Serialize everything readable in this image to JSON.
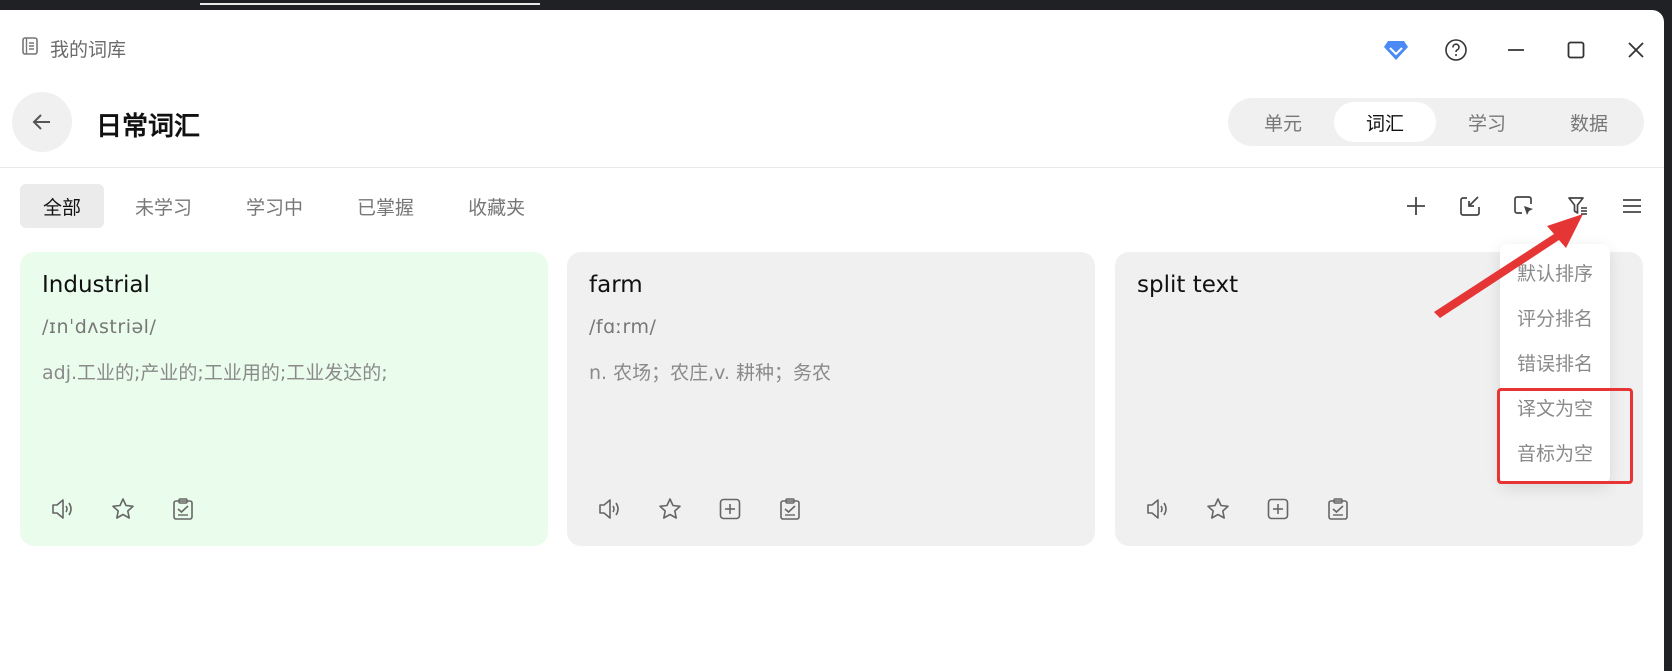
{
  "window": {
    "title": "我的词库"
  },
  "header": {
    "title": "日常词汇",
    "segments": [
      {
        "label": "单元",
        "active": false
      },
      {
        "label": "词汇",
        "active": true
      },
      {
        "label": "学习",
        "active": false
      },
      {
        "label": "数据",
        "active": false
      }
    ]
  },
  "filters": [
    {
      "label": "全部",
      "active": true
    },
    {
      "label": "未学习",
      "active": false
    },
    {
      "label": "学习中",
      "active": false
    },
    {
      "label": "已掌握",
      "active": false
    },
    {
      "label": "收藏夹",
      "active": false
    }
  ],
  "toolbar": {
    "icons": [
      "plus-icon",
      "import-icon",
      "select-icon",
      "filter-sort-icon",
      "menu-icon"
    ]
  },
  "cards": [
    {
      "word": "Industrial",
      "phonetic": "/ɪnˈdʌstriəl/",
      "translation": "adj.工业的;产业的;工业用的;工业发达的;",
      "status": "learned"
    },
    {
      "word": "farm",
      "phonetic": "/fɑːrm/",
      "translation": "n. 农场；农庄,v. 耕种；务农",
      "status": "normal"
    },
    {
      "word": "split text",
      "phonetic": "",
      "translation": "",
      "status": "normal"
    }
  ],
  "sort_menu": {
    "items": [
      "默认排序",
      "评分排名",
      "错误排名",
      "译文为空",
      "音标为空"
    ],
    "highlighted": [
      "译文为空",
      "音标为空"
    ]
  },
  "colors": {
    "accent_blue": "#3b82f6",
    "learned_card": "#eafceb",
    "annotation_red": "#e53535"
  }
}
